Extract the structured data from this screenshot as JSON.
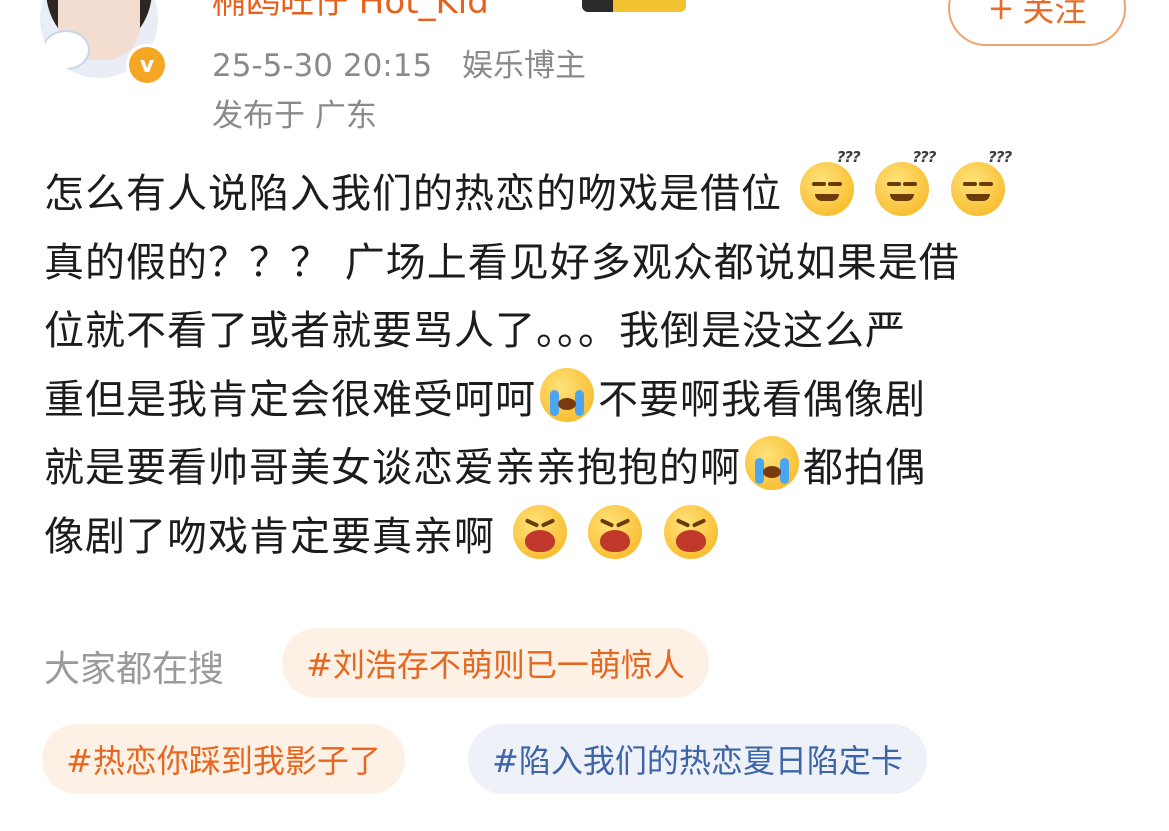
{
  "header": {
    "username": "椭鸥旺仔 Hot_Kid",
    "timestamp": "25-5-30 20:15",
    "user_type": "娱乐博主",
    "location": "发布于 广东",
    "follow_label": "关注",
    "follow_icon": "plus"
  },
  "post": {
    "line1": "怎么有人说陷入我们的热恋的吻戏是借位",
    "line2": "真的假的？？？ 广场上看见好多观众都说如果是借",
    "line3": "位就不看了或者就要骂人了。。。我倒是没这么严",
    "line4a": "重但是我肯定会很难受呵呵",
    "line4b": "不要啊我看偶像剧",
    "line5a": "就是要看帅哥美女谈恋爱亲亲抱抱的啊",
    "line5b": "都拍偶",
    "line6": "像剧了吻戏肯定要真亲啊",
    "emoji_names": [
      "doge-confused-emoji",
      "crying-emoji",
      "shouting-emoji"
    ]
  },
  "hot_search": {
    "label": "大家都在搜",
    "chips": [
      {
        "text": "#刘浩存不萌则已一萌惊人"
      },
      {
        "text": "#热恋你踩到我影子了"
      },
      {
        "text": "#陷入我们的热恋夏日陷定卡"
      }
    ]
  },
  "colors": {
    "accent_orange": "#e8671f",
    "chip_orange_bg": "#fdf1e6",
    "chip_blue_bg": "#eef2f8",
    "chip_blue_text": "#3d64a8",
    "meta_gray": "#8a8a8a"
  }
}
